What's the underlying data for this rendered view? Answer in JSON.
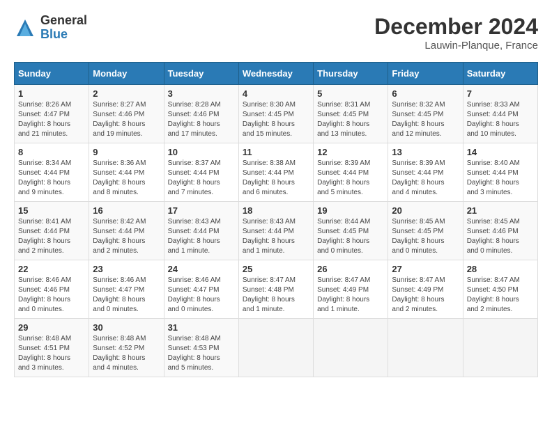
{
  "logo": {
    "general": "General",
    "blue": "Blue"
  },
  "title": "December 2024",
  "subtitle": "Lauwin-Planque, France",
  "days_of_week": [
    "Sunday",
    "Monday",
    "Tuesday",
    "Wednesday",
    "Thursday",
    "Friday",
    "Saturday"
  ],
  "weeks": [
    [
      {
        "day": "1",
        "info": "Sunrise: 8:26 AM\nSunset: 4:47 PM\nDaylight: 8 hours\nand 21 minutes."
      },
      {
        "day": "2",
        "info": "Sunrise: 8:27 AM\nSunset: 4:46 PM\nDaylight: 8 hours\nand 19 minutes."
      },
      {
        "day": "3",
        "info": "Sunrise: 8:28 AM\nSunset: 4:46 PM\nDaylight: 8 hours\nand 17 minutes."
      },
      {
        "day": "4",
        "info": "Sunrise: 8:30 AM\nSunset: 4:45 PM\nDaylight: 8 hours\nand 15 minutes."
      },
      {
        "day": "5",
        "info": "Sunrise: 8:31 AM\nSunset: 4:45 PM\nDaylight: 8 hours\nand 13 minutes."
      },
      {
        "day": "6",
        "info": "Sunrise: 8:32 AM\nSunset: 4:45 PM\nDaylight: 8 hours\nand 12 minutes."
      },
      {
        "day": "7",
        "info": "Sunrise: 8:33 AM\nSunset: 4:44 PM\nDaylight: 8 hours\nand 10 minutes."
      }
    ],
    [
      {
        "day": "8",
        "info": "Sunrise: 8:34 AM\nSunset: 4:44 PM\nDaylight: 8 hours\nand 9 minutes."
      },
      {
        "day": "9",
        "info": "Sunrise: 8:36 AM\nSunset: 4:44 PM\nDaylight: 8 hours\nand 8 minutes."
      },
      {
        "day": "10",
        "info": "Sunrise: 8:37 AM\nSunset: 4:44 PM\nDaylight: 8 hours\nand 7 minutes."
      },
      {
        "day": "11",
        "info": "Sunrise: 8:38 AM\nSunset: 4:44 PM\nDaylight: 8 hours\nand 6 minutes."
      },
      {
        "day": "12",
        "info": "Sunrise: 8:39 AM\nSunset: 4:44 PM\nDaylight: 8 hours\nand 5 minutes."
      },
      {
        "day": "13",
        "info": "Sunrise: 8:39 AM\nSunset: 4:44 PM\nDaylight: 8 hours\nand 4 minutes."
      },
      {
        "day": "14",
        "info": "Sunrise: 8:40 AM\nSunset: 4:44 PM\nDaylight: 8 hours\nand 3 minutes."
      }
    ],
    [
      {
        "day": "15",
        "info": "Sunrise: 8:41 AM\nSunset: 4:44 PM\nDaylight: 8 hours\nand 2 minutes."
      },
      {
        "day": "16",
        "info": "Sunrise: 8:42 AM\nSunset: 4:44 PM\nDaylight: 8 hours\nand 2 minutes."
      },
      {
        "day": "17",
        "info": "Sunrise: 8:43 AM\nSunset: 4:44 PM\nDaylight: 8 hours\nand 1 minute."
      },
      {
        "day": "18",
        "info": "Sunrise: 8:43 AM\nSunset: 4:44 PM\nDaylight: 8 hours\nand 1 minute."
      },
      {
        "day": "19",
        "info": "Sunrise: 8:44 AM\nSunset: 4:45 PM\nDaylight: 8 hours\nand 0 minutes."
      },
      {
        "day": "20",
        "info": "Sunrise: 8:45 AM\nSunset: 4:45 PM\nDaylight: 8 hours\nand 0 minutes."
      },
      {
        "day": "21",
        "info": "Sunrise: 8:45 AM\nSunset: 4:46 PM\nDaylight: 8 hours\nand 0 minutes."
      }
    ],
    [
      {
        "day": "22",
        "info": "Sunrise: 8:46 AM\nSunset: 4:46 PM\nDaylight: 8 hours\nand 0 minutes."
      },
      {
        "day": "23",
        "info": "Sunrise: 8:46 AM\nSunset: 4:47 PM\nDaylight: 8 hours\nand 0 minutes."
      },
      {
        "day": "24",
        "info": "Sunrise: 8:46 AM\nSunset: 4:47 PM\nDaylight: 8 hours\nand 0 minutes."
      },
      {
        "day": "25",
        "info": "Sunrise: 8:47 AM\nSunset: 4:48 PM\nDaylight: 8 hours\nand 1 minute."
      },
      {
        "day": "26",
        "info": "Sunrise: 8:47 AM\nSunset: 4:49 PM\nDaylight: 8 hours\nand 1 minute."
      },
      {
        "day": "27",
        "info": "Sunrise: 8:47 AM\nSunset: 4:49 PM\nDaylight: 8 hours\nand 2 minutes."
      },
      {
        "day": "28",
        "info": "Sunrise: 8:47 AM\nSunset: 4:50 PM\nDaylight: 8 hours\nand 2 minutes."
      }
    ],
    [
      {
        "day": "29",
        "info": "Sunrise: 8:48 AM\nSunset: 4:51 PM\nDaylight: 8 hours\nand 3 minutes."
      },
      {
        "day": "30",
        "info": "Sunrise: 8:48 AM\nSunset: 4:52 PM\nDaylight: 8 hours\nand 4 minutes."
      },
      {
        "day": "31",
        "info": "Sunrise: 8:48 AM\nSunset: 4:53 PM\nDaylight: 8 hours\nand 5 minutes."
      },
      null,
      null,
      null,
      null
    ]
  ]
}
